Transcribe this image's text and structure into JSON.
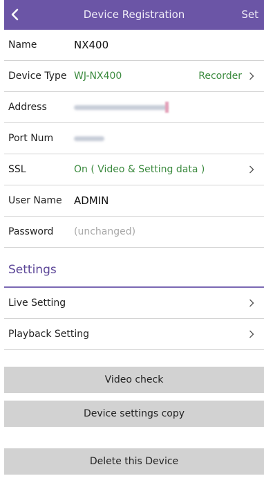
{
  "header": {
    "title": "Device Registration",
    "set_label": "Set",
    "back_icon": "chevron-left-icon",
    "bg_color": "#6b55a6"
  },
  "fields": {
    "name": {
      "label": "Name",
      "value": "NX400"
    },
    "device_type": {
      "label": "Device Type",
      "value": "WJ-NX400",
      "category": "Recorder"
    },
    "address": {
      "label": "Address"
    },
    "port": {
      "label": "Port Num"
    },
    "ssl": {
      "label": "SSL",
      "value": "On ( Video & Setting data )"
    },
    "user_name": {
      "label": "User Name",
      "value": "ADMIN"
    },
    "password": {
      "label": "Password",
      "value": "(unchanged)"
    }
  },
  "settings": {
    "title": "Settings",
    "live": "Live Setting",
    "playback": "Playback Setting"
  },
  "buttons": {
    "video_check": "Video check",
    "copy": "Device settings copy",
    "delete": "Delete this Device"
  },
  "colors": {
    "accent": "#6b55a6",
    "value_green": "#3b8a3e",
    "button_gray": "#d2d2d2"
  }
}
